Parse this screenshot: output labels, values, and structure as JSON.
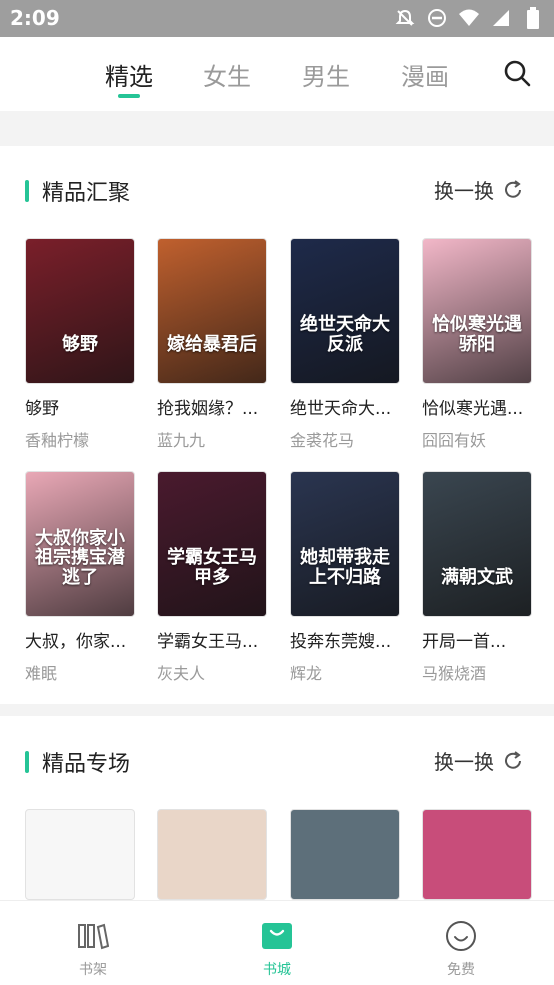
{
  "status": {
    "time": "2:09"
  },
  "tabs": [
    {
      "label": "精选"
    },
    {
      "label": "女生"
    },
    {
      "label": "男生"
    },
    {
      "label": "漫画"
    }
  ],
  "sections": [
    {
      "title": "精品汇聚",
      "refresh_label": "换一换"
    },
    {
      "title": "精品专场",
      "refresh_label": "换一换"
    }
  ],
  "books": [
    {
      "title": "够野",
      "author": "香釉柠檬",
      "cover_text": "够野",
      "cover_color": "#7a1f2a"
    },
    {
      "title": "抢我姻缘？...",
      "author": "蓝九九",
      "cover_text": "嫁给暴君后",
      "cover_color": "#c0602e"
    },
    {
      "title": "绝世天命大...",
      "author": "金裘花马",
      "cover_text": "绝世天命大反派",
      "cover_color": "#1e2a4a"
    },
    {
      "title": "恰似寒光遇...",
      "author": "囧囧有妖",
      "cover_text": "恰似寒光遇骄阳",
      "cover_color": "#f2b7c8"
    },
    {
      "title": "大叔，你家...",
      "author": "难眠",
      "cover_text": "大叔你家小祖宗携宝潜逃了",
      "cover_color": "#e9a8b6"
    },
    {
      "title": "学霸女王马...",
      "author": "灰夫人",
      "cover_text": "学霸女王马甲多",
      "cover_color": "#4a1a2e"
    },
    {
      "title": "投奔东莞嫂...",
      "author": "辉龙",
      "cover_text": "她却带我走上不归路",
      "cover_color": "#2a3550"
    },
    {
      "title": "开局一首...",
      "author": "马猴烧酒",
      "cover_text": "满朝文武",
      "cover_color": "#3a4650"
    }
  ],
  "nav": [
    {
      "label": "书架"
    },
    {
      "label": "书城"
    },
    {
      "label": "免费"
    }
  ],
  "colors": {
    "accent": "#25c496",
    "muted": "#9a9a9a"
  }
}
